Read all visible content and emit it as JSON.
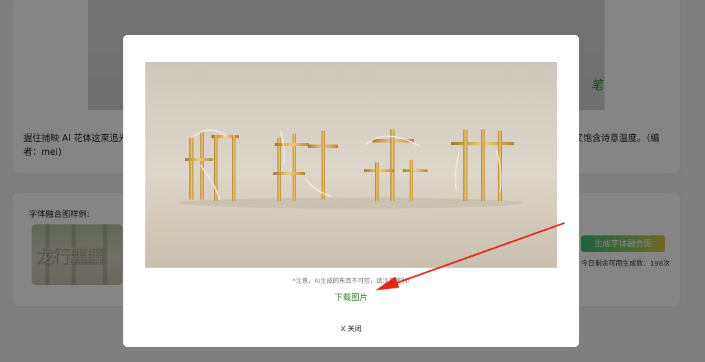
{
  "background": {
    "description_text": "握住捕映 AI 花体这束追光",
    "description_text_2": "者：mei)",
    "description_tail": "又饱含诗意温度。（编",
    "signature_fragment": "笔",
    "samples_label": "字体融合图样例:",
    "sample_thumb_text": "龙行龘龘",
    "generate_button": "生成字体融合图",
    "quota_text": "今日剩余可用生成数：198次"
  },
  "modal": {
    "result_glyphs": [
      "钢",
      "铁",
      "森",
      "林"
    ],
    "notice": "*注意，AI生成的东西不可控，请注意甄别!",
    "download_label": "下载图片",
    "close_label": "X 关闭"
  },
  "colors": {
    "accent_green": "#2e7d32",
    "arrow_red": "#e3241b",
    "gold": "#c99a3a"
  }
}
